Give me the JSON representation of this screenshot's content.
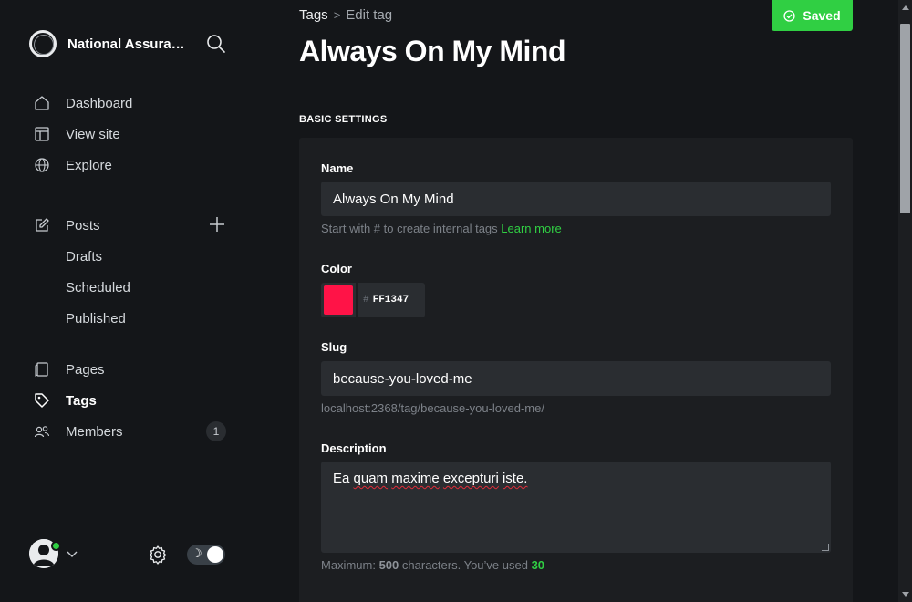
{
  "sidebar": {
    "brand_name": "National Assurance",
    "icons": {
      "brand": "brand-logo-icon",
      "search": "search-icon"
    },
    "nav_main": [
      {
        "label": "Dashboard",
        "icon": "home-icon"
      },
      {
        "label": "View site",
        "icon": "layout-icon"
      },
      {
        "label": "Explore",
        "icon": "globe-icon"
      }
    ],
    "posts": {
      "label": "Posts",
      "icon": "pencil-square-icon",
      "add_icon": "plus-icon",
      "sub_items": [
        "Drafts",
        "Scheduled",
        "Published"
      ]
    },
    "nav_bottom": [
      {
        "label": "Pages",
        "icon": "page-icon"
      },
      {
        "label": "Tags",
        "icon": "tag-icon",
        "active": true
      },
      {
        "label": "Members",
        "icon": "users-icon",
        "count": "1"
      }
    ],
    "footer": {
      "avatar_icon": "user-avatar-icon",
      "status_color": "#30cf43",
      "settings_icon": "gear-icon",
      "theme_toggle_icon": "moon-icon",
      "dark_mode": true
    }
  },
  "header": {
    "breadcrumb_parent": "Tags",
    "breadcrumb_separator": ">",
    "breadcrumb_current": "Edit tag",
    "title": "Always On My Mind",
    "saved_label": "Saved",
    "saved_color": "#30cf43"
  },
  "form": {
    "section_label": "BASIC SETTINGS",
    "name": {
      "label": "Name",
      "value": "Always On My Mind",
      "hint": "Start with # to create internal tags",
      "hint_link": "Learn more"
    },
    "color": {
      "label": "Color",
      "hash": "#",
      "value": "FF1347",
      "swatch": "#ff1347"
    },
    "slug": {
      "label": "Slug",
      "value": "because-you-loved-me",
      "url_preview": "localhost:2368/tag/because-you-loved-me/"
    },
    "description": {
      "label": "Description",
      "words": [
        "Ea",
        "quam",
        "maxime",
        "excepturi",
        "iste."
      ],
      "hint_prefix": "Maximum:",
      "max": "500",
      "hint_middle": "characters. You’ve used",
      "used": "30"
    }
  }
}
